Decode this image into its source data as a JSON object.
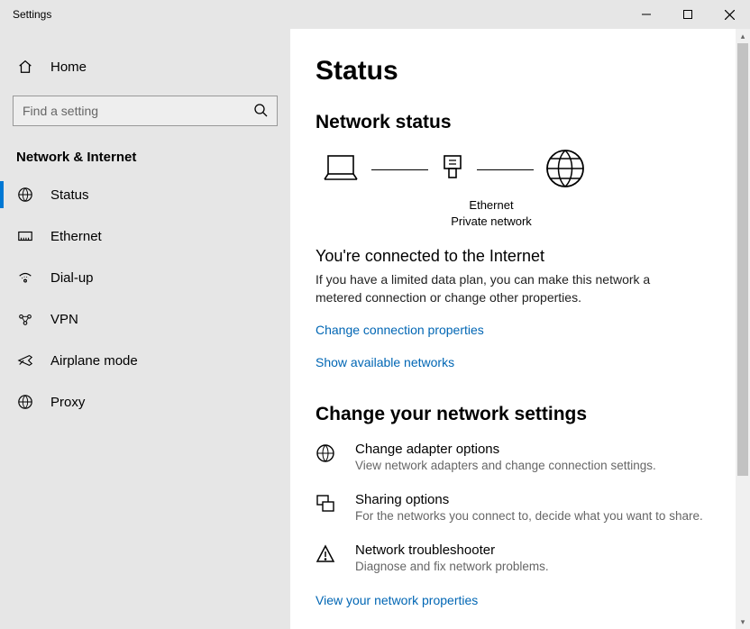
{
  "window": {
    "title": "Settings"
  },
  "sidebar": {
    "home": "Home",
    "search_placeholder": "Find a setting",
    "section": "Network & Internet",
    "items": [
      {
        "label": "Status",
        "icon": "status-icon",
        "active": true
      },
      {
        "label": "Ethernet",
        "icon": "ethernet-icon",
        "active": false
      },
      {
        "label": "Dial-up",
        "icon": "dialup-icon",
        "active": false
      },
      {
        "label": "VPN",
        "icon": "vpn-icon",
        "active": false
      },
      {
        "label": "Airplane mode",
        "icon": "airplane-icon",
        "active": false
      },
      {
        "label": "Proxy",
        "icon": "proxy-icon",
        "active": false
      }
    ]
  },
  "page": {
    "title": "Status",
    "network_status_header": "Network status",
    "diagram": {
      "connection_name": "Ethernet",
      "network_type": "Private network"
    },
    "connected_title": "You're connected to the Internet",
    "connected_desc": "If you have a limited data plan, you can make this network a metered connection or change other properties.",
    "link_change_props": "Change connection properties",
    "link_show_networks": "Show available networks",
    "change_settings_header": "Change your network settings",
    "options": [
      {
        "title": "Change adapter options",
        "desc": "View network adapters and change connection settings."
      },
      {
        "title": "Sharing options",
        "desc": "For the networks you connect to, decide what you want to share."
      },
      {
        "title": "Network troubleshooter",
        "desc": "Diagnose and fix network problems."
      }
    ],
    "link_view_props": "View your network properties"
  }
}
